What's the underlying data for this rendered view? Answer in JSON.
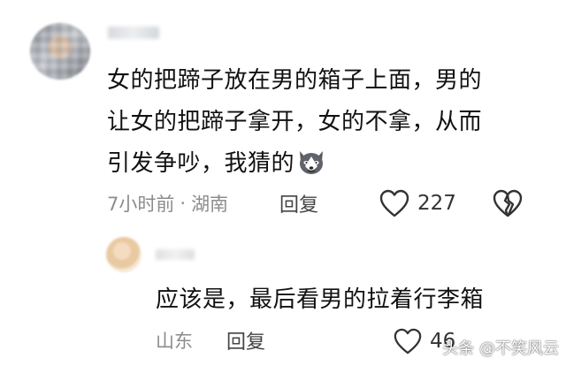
{
  "comment": {
    "lines": [
      "女的把蹄子放在男的箱子上面，男的",
      "让女的把蹄子拿开，女的不拿，从而",
      "引发争吵，我猜的"
    ],
    "emoji": "husky-emoji",
    "time": "7小时前",
    "separator": "·",
    "location": "湖南",
    "reply_label": "回复",
    "like_count": "227"
  },
  "reply": {
    "text": "应该是，最后看男的拉着行李箱",
    "location": "山东",
    "reply_label": "回复",
    "like_count": "46"
  },
  "watermark": {
    "text": "头条 @不笑风云"
  },
  "icons": {
    "like": "heart-outline-icon",
    "dislike": "broken-heart-icon"
  },
  "colors": {
    "text": "#111111",
    "meta": "#8c8c8c",
    "icon": "#333333"
  }
}
